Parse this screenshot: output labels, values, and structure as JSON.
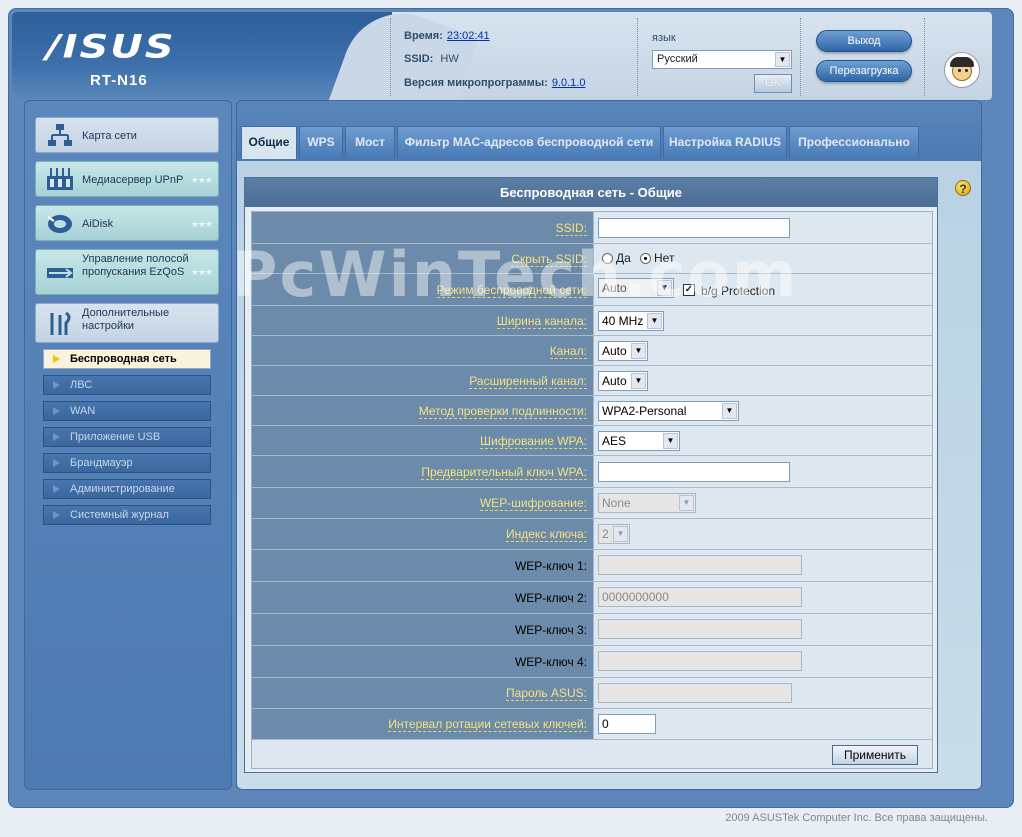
{
  "header": {
    "brand": "/ISUS",
    "model": "RT-N16",
    "time_label": "Время:",
    "time_value": "23:02:41",
    "ssid_label": "SSID:",
    "ssid_value": "HW",
    "firmware_label": "Версия микропрограммы:",
    "firmware_value": "9.0.1.0",
    "language_label": "язык",
    "language_value": "Русский",
    "ok_label": "OK",
    "logout_label": "Выход",
    "reboot_label": "Перезагрузка"
  },
  "sidebar": {
    "items": [
      {
        "label": "Карта сети",
        "icon": "network-map-icon"
      },
      {
        "label": "Медиасервер UPnP",
        "icon": "media-server-icon",
        "stars": "★★★"
      },
      {
        "label": "AiDisk",
        "icon": "aidisk-icon",
        "stars": "★★★"
      },
      {
        "label": "Управление полосой пропускания EzQoS",
        "icon": "ezqos-icon",
        "stars": "★★★"
      },
      {
        "label": "Дополнительные настройки",
        "icon": "advanced-settings-icon"
      }
    ],
    "subitems": [
      {
        "label": "Беспроводная сеть",
        "active": true
      },
      {
        "label": "ЛВС"
      },
      {
        "label": "WAN"
      },
      {
        "label": "Приложение USB"
      },
      {
        "label": "Брандмауэр"
      },
      {
        "label": "Администрирование"
      },
      {
        "label": "Системный журнал"
      }
    ]
  },
  "tabs": [
    "Общие",
    "WPS",
    "Мост",
    "Фильтр MAC-адресов беспроводной сети",
    "Настройка RADIUS",
    "Профессионально"
  ],
  "content": {
    "title": "Беспроводная сеть - Общие",
    "watermark": "PcWinTech.com",
    "fields": {
      "ssid_label": "SSID:",
      "ssid_value": "",
      "hide_ssid_label": "Скрыть SSID:",
      "hide_yes": "Да",
      "hide_no": "Нет",
      "mode_label": "Режим беспроводной сети:",
      "mode_value": "Auto",
      "bg_protection_label": "b/g Protection",
      "bandwidth_label": "Ширина канала:",
      "bandwidth_value": "40 MHz",
      "channel_label": "Канал:",
      "channel_value": "Auto",
      "ext_channel_label": "Расширенный канал:",
      "ext_channel_value": "Auto",
      "auth_label": "Метод проверки подлинности:",
      "auth_value": "WPA2-Personal",
      "wpa_enc_label": "Шифрование WPA:",
      "wpa_enc_value": "AES",
      "psk_label": "Предварительный ключ WPA:",
      "psk_value": "",
      "wep_enc_label": "WEP-шифрование:",
      "wep_enc_value": "None",
      "key_index_label": "Индекс ключа:",
      "key_index_value": "2",
      "wep1_label": "WEP-ключ 1:",
      "wep1_value": "",
      "wep2_label": "WEP-ключ 2:",
      "wep2_value": "0000000000",
      "wep3_label": "WEP-ключ 3:",
      "wep3_value": "",
      "wep4_label": "WEP-ключ 4:",
      "wep4_value": "",
      "asus_pass_label": "Пароль ASUS:",
      "asus_pass_value": "",
      "rekey_label": "Интервал ротации сетевых ключей:",
      "rekey_value": "0",
      "apply_label": "Применить"
    }
  },
  "footer": "2009 ASUSTek Computer Inc. Все права защищены."
}
